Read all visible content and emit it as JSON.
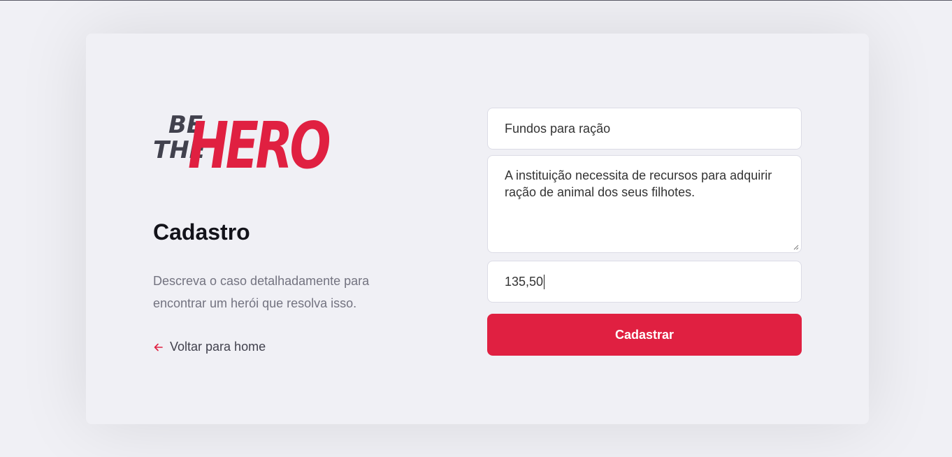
{
  "logo": {
    "line1": "BE",
    "line2": "THE",
    "word": "HERO",
    "alt": "Be The Hero"
  },
  "header": {
    "title": "Cadastro",
    "description": "Descreva o caso detalhadamente para encontrar um herói que resolva isso."
  },
  "nav": {
    "back_label": "Voltar para home",
    "back_icon": "arrow-left-icon"
  },
  "form": {
    "title_value": "Fundos para ração",
    "description_value": "A instituição necessita de recursos para adquirir ração de animal dos seus filhotes.",
    "amount_value": "135,50",
    "submit_label": "Cadastrar"
  },
  "colors": {
    "accent": "#e02041",
    "background": "#f0f0f5",
    "text_dark": "#13131a",
    "text_muted": "#737380",
    "logo_dark": "#41414d"
  }
}
